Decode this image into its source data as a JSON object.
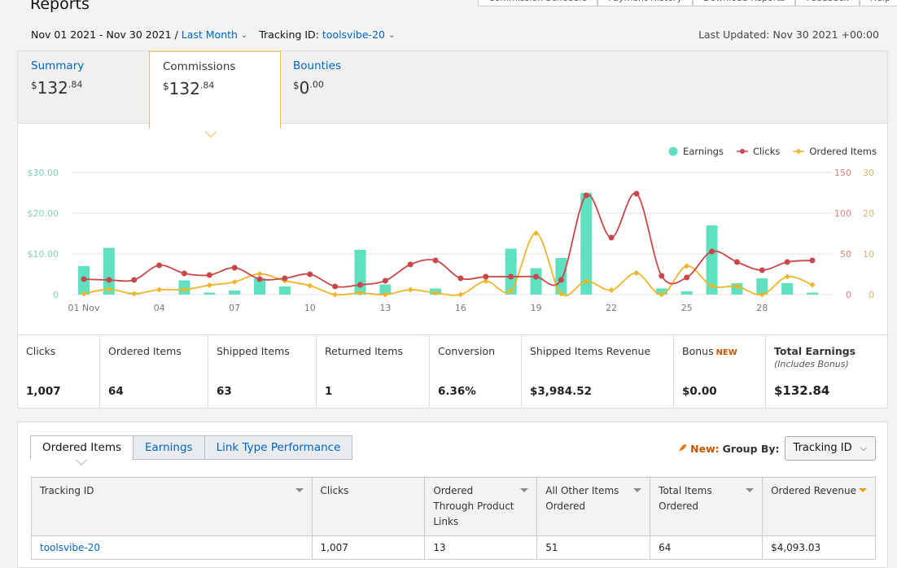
{
  "title": "Reports",
  "top_tabs": [
    "Commission Schedule",
    "Payment History",
    "Download Reports",
    "Feedback",
    "Help"
  ],
  "filter": {
    "date_range": "Nov 01 2021 - Nov 30 2021",
    "separator": "/",
    "period": "Last Month",
    "tracking_label": "Tracking ID:",
    "tracking_value": "toolsvibe-20",
    "last_updated": "Last Updated: Nov 30 2021 +00:00"
  },
  "summary_tabs": [
    {
      "label": "Summary",
      "currency": "$",
      "whole": "132",
      "cents": ".84"
    },
    {
      "label": "Commissions",
      "currency": "$",
      "whole": "132",
      "cents": ".84"
    },
    {
      "label": "Bounties",
      "currency": "$",
      "whole": "0",
      "cents": ".00"
    }
  ],
  "legend": {
    "earnings": "Earnings",
    "clicks": "Clicks",
    "ordered": "Ordered Items"
  },
  "colors": {
    "earnings": "#5fe0c1",
    "clicks": "#c9474a",
    "ordered": "#f0b429",
    "link": "#0066c0"
  },
  "chart_data": {
    "type": "bar",
    "x": [
      1,
      2,
      3,
      4,
      5,
      6,
      7,
      8,
      9,
      10,
      11,
      12,
      13,
      14,
      15,
      16,
      17,
      18,
      19,
      20,
      21,
      22,
      23,
      24,
      25,
      26,
      27,
      28,
      29
    ],
    "x_tick_labels": [
      "01 Nov",
      "04",
      "07",
      "10",
      "13",
      "16",
      "19",
      "22",
      "25",
      "28"
    ],
    "x_tick_values": [
      1,
      4,
      7,
      10,
      13,
      16,
      19,
      22,
      25,
      28
    ],
    "y_left": {
      "ticks": [
        "0",
        "$10.00",
        "$20.00",
        "$30.00"
      ],
      "lim": [
        0,
        30
      ]
    },
    "y_right_clicks": {
      "ticks": [
        "0",
        "50",
        "100",
        "150"
      ],
      "lim": [
        0,
        150
      ]
    },
    "y_right_ordered": {
      "ticks": [
        "0",
        "10",
        "20",
        "30"
      ],
      "lim": [
        0,
        30
      ]
    },
    "series": [
      {
        "name": "Earnings",
        "kind": "bar",
        "values": [
          7,
          11.5,
          0.5,
          0,
          3.5,
          0.5,
          1,
          4,
          2,
          0,
          0,
          11,
          2.5,
          0,
          1.5,
          0,
          0,
          11.3,
          6.5,
          9,
          25,
          0,
          0,
          1.5,
          0.8,
          17,
          2.8,
          4,
          2.8,
          0.5
        ]
      },
      {
        "name": "Clicks",
        "kind": "line",
        "values": [
          19,
          18,
          18,
          36,
          26,
          24,
          33,
          19,
          20,
          25,
          10,
          12,
          17,
          37,
          42,
          20,
          22,
          22,
          22,
          18,
          122,
          70,
          124,
          23,
          21,
          53,
          40,
          30,
          40,
          42
        ]
      },
      {
        "name": "Ordered Items",
        "kind": "line",
        "values": [
          0.2,
          1.3,
          0.2,
          1.2,
          1.2,
          2.3,
          3.1,
          5.1,
          3.4,
          2.2,
          0,
          0.4,
          0,
          1.2,
          0.4,
          0,
          3.3,
          1,
          15.1,
          0.2,
          3.3,
          1.1,
          5.3,
          0,
          7,
          2.1,
          2,
          0,
          4.4,
          2.4
        ]
      }
    ]
  },
  "stats": [
    {
      "label": "Clicks",
      "value": "1,007"
    },
    {
      "label": "Ordered Items",
      "value": "64"
    },
    {
      "label": "Shipped Items",
      "value": "63"
    },
    {
      "label": "Returned Items",
      "value": "1"
    },
    {
      "label": "Conversion",
      "value": "6.36%"
    },
    {
      "label": "Shipped Items Revenue",
      "value": "$3,984.52"
    },
    {
      "label": "Bonus",
      "badge": "NEW",
      "value": "$0.00"
    },
    {
      "label": "Total Earnings",
      "sub": "(Includes Bonus)",
      "value": "$132.84"
    }
  ],
  "report_tabs": [
    "Ordered Items",
    "Earnings",
    "Link Type Performance"
  ],
  "group_by": {
    "new_label": "New:",
    "label": "Group By:",
    "value": "Tracking ID"
  },
  "table": {
    "headers": [
      "Tracking ID",
      "Clicks",
      "Ordered Through Product Links",
      "All Other Items Ordered",
      "Total Items Ordered",
      "Ordered Revenue"
    ],
    "rows": [
      [
        "toolsvibe-20",
        "1,007",
        "13",
        "51",
        "64",
        "$4,093.03"
      ]
    ]
  }
}
